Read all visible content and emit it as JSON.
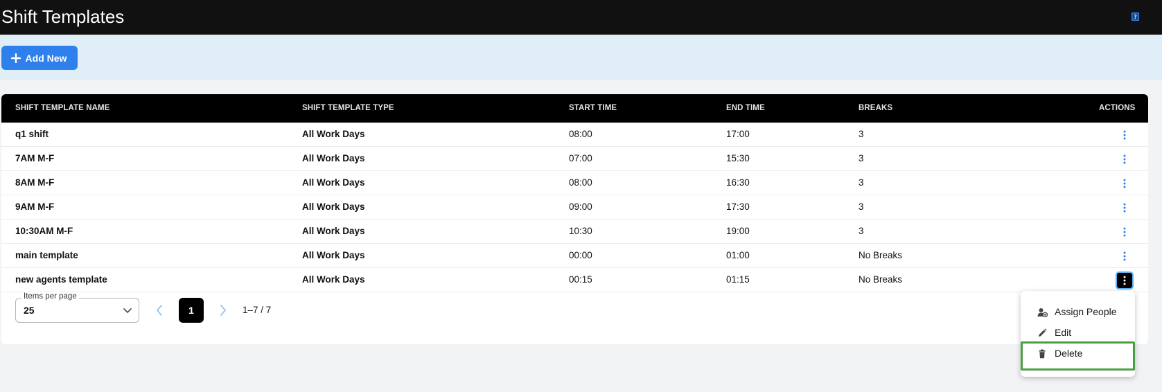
{
  "header": {
    "title": "Shift Templates",
    "help_icon": "help-book-icon"
  },
  "toolbar": {
    "add_label": "Add New"
  },
  "table": {
    "columns": [
      "SHIFT TEMPLATE NAME",
      "SHIFT TEMPLATE TYPE",
      "START TIME",
      "END TIME",
      "BREAKS",
      "ACTIONS"
    ],
    "rows": [
      {
        "name": "q1 shift",
        "type": "All Work Days",
        "start": "08:00",
        "end": "17:00",
        "breaks": "3"
      },
      {
        "name": "7AM M-F",
        "type": "All Work Days",
        "start": "07:00",
        "end": "15:30",
        "breaks": "3"
      },
      {
        "name": "8AM M-F",
        "type": "All Work Days",
        "start": "08:00",
        "end": "16:30",
        "breaks": "3"
      },
      {
        "name": "9AM M-F",
        "type": "All Work Days",
        "start": "09:00",
        "end": "17:30",
        "breaks": "3"
      },
      {
        "name": "10:30AM M-F",
        "type": "All Work Days",
        "start": "10:30",
        "end": "19:00",
        "breaks": "3"
      },
      {
        "name": "main template",
        "type": "All Work Days",
        "start": "00:00",
        "end": "01:00",
        "breaks": "No Breaks"
      },
      {
        "name": "new agents template",
        "type": "All Work Days",
        "start": "00:15",
        "end": "01:15",
        "breaks": "No Breaks"
      }
    ]
  },
  "pagination": {
    "items_per_page_label": "Items per page",
    "items_per_page_value": "25",
    "current_page": "1",
    "range": "1–7 / 7"
  },
  "action_menu": {
    "items": [
      {
        "label": "Assign People",
        "icon": "assign-person-icon"
      },
      {
        "label": "Edit",
        "icon": "pencil-icon"
      },
      {
        "label": "Delete",
        "icon": "trash-icon"
      }
    ]
  },
  "colors": {
    "accent": "#2f80ed",
    "header_bg": "#111111",
    "toolbar_bg": "#dfeef7",
    "highlight": "#4a9e44"
  }
}
